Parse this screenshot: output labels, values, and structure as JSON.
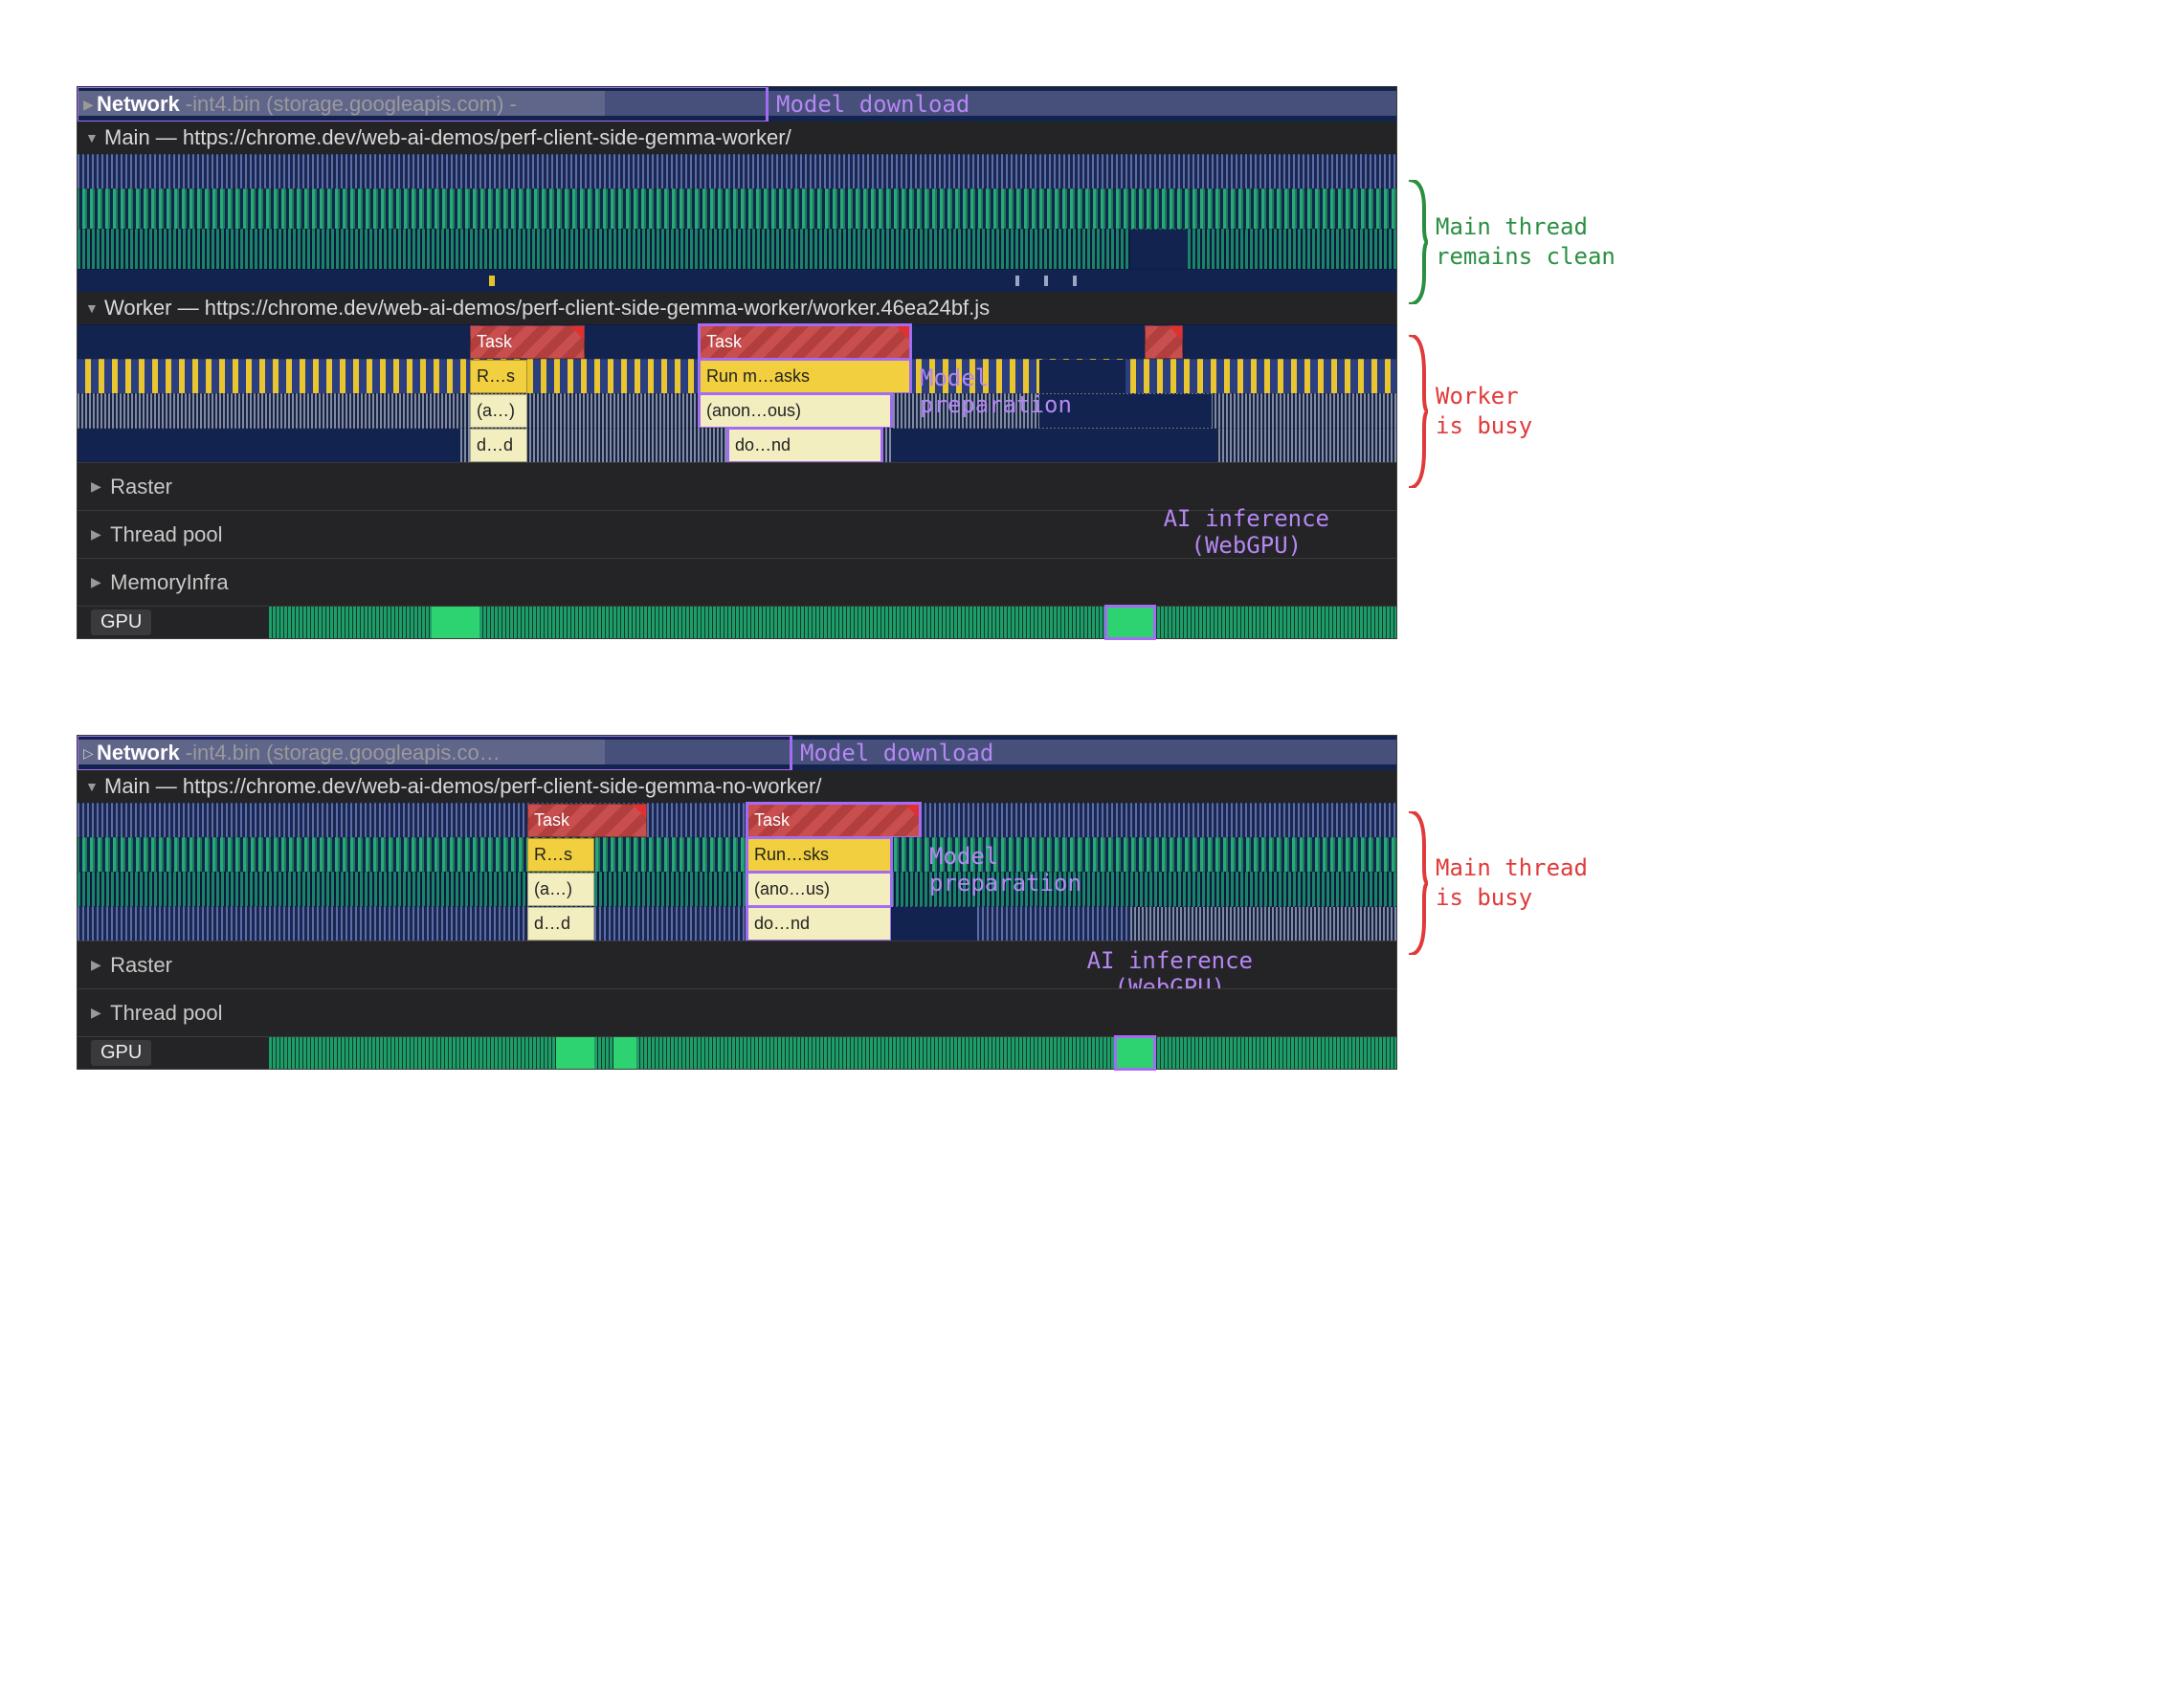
{
  "figure1": {
    "network": {
      "title": "Network",
      "detail": "-int4.bin (storage.googleapis.com) -",
      "annot": "Model download"
    },
    "main": {
      "title": "Main — https://chrome.dev/web-ai-demos/perf-client-side-gemma-worker/"
    },
    "worker": {
      "title": "Worker — https://chrome.dev/web-ai-demos/perf-client-side-gemma-worker/worker.46ea24bf.js"
    },
    "tasks": {
      "task_a": "Task",
      "task_b": "Task",
      "rs": "R…s",
      "run": "Run m…asks",
      "anon_a": "(a…)",
      "anon_b": "(anon…ous)",
      "dd": "d…d",
      "dond": "do…nd"
    },
    "model_prep": "Model\npreparation",
    "ai_inf": "AI inference\n(WebGPU)",
    "tracks": {
      "raster": "Raster",
      "threadpool": "Thread pool",
      "meminfra": "MemoryInfra",
      "gpu": "GPU"
    },
    "side_annot": {
      "clean": "Main thread\nremains clean",
      "busy": "Worker\nis busy"
    }
  },
  "figure2": {
    "network": {
      "title": "Network",
      "detail": "-int4.bin (storage.googleapis.co… ",
      "annot": "Model download"
    },
    "main": {
      "title": "Main — https://chrome.dev/web-ai-demos/perf-client-side-gemma-no-worker/"
    },
    "tasks": {
      "task_a": "Task",
      "task_b": "Task",
      "rs": "R…s",
      "run": "Run…sks",
      "anon_a": "(a…)",
      "anon_b": "(ano…us)",
      "dd": "d…d",
      "dond": "do…nd"
    },
    "model_prep": "Model\npreparation",
    "ai_inf": "AI inference\n(WebGPU)",
    "tracks": {
      "raster": "Raster",
      "threadpool": "Thread pool",
      "gpu": "GPU"
    },
    "side_annot": {
      "busy": "Main thread\nis busy"
    }
  },
  "colors": {
    "green": "#2a8f41",
    "red": "#e03a3a",
    "purple": "#a36cf2"
  }
}
